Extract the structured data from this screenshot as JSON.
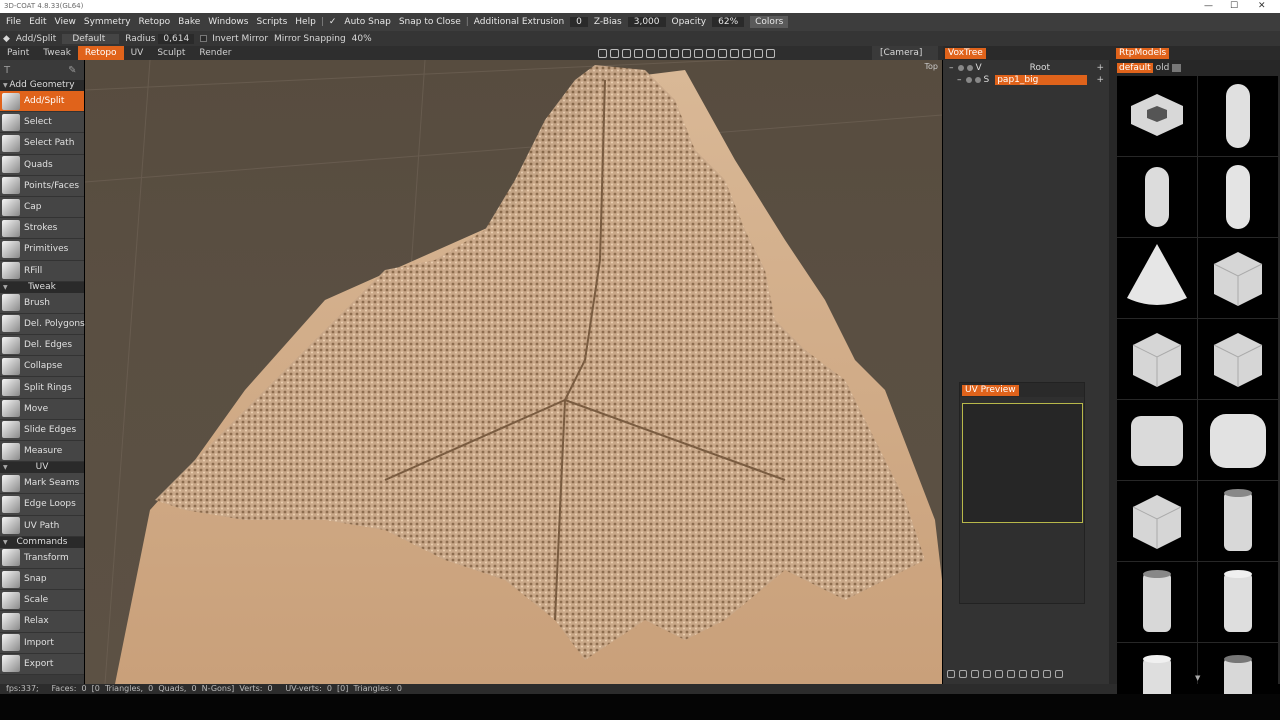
{
  "window": {
    "title": "3D-COAT 4.8.33(GL64)",
    "minimize": "—",
    "maximize": "☐",
    "close": "✕"
  },
  "menu": {
    "items": [
      "File",
      "Edit",
      "View",
      "Symmetry",
      "Retopo",
      "Bake",
      "Windows",
      "Scripts",
      "Help"
    ],
    "auto_snap": "Auto Snap",
    "snap_to_close": "Snap to Close",
    "additional_extrusion_label": "Additional Extrusion",
    "additional_extrusion_value": "0",
    "zbias_label": "Z-Bias",
    "zbias_value": "3,000",
    "opacity_label": "Opacity",
    "opacity_value": "62%",
    "colors": "Colors"
  },
  "options": {
    "tool": "Add/Split",
    "preset": "Default",
    "radius_label": "Radius",
    "radius_value": "0,614",
    "invert_mirror": "Invert Mirror",
    "mirror_snapping_label": "Mirror Snapping",
    "mirror_snapping_value": "40%"
  },
  "tabs": [
    {
      "label": "Paint",
      "active": false
    },
    {
      "label": "Tweak",
      "active": false
    },
    {
      "label": "Retopo",
      "active": true
    },
    {
      "label": "UV",
      "active": false
    },
    {
      "label": "Sculpt",
      "active": false
    },
    {
      "label": "Render",
      "active": false
    }
  ],
  "camera": "[Camera]",
  "viewport": {
    "view_label": "Top"
  },
  "toolbar": {
    "sections": [
      {
        "title": "Add Geometry",
        "tools": [
          {
            "label": "Add/Split",
            "active": true
          },
          {
            "label": "Select"
          },
          {
            "label": "Select Path"
          },
          {
            "label": "Quads"
          },
          {
            "label": "Points/Faces"
          },
          {
            "label": "Cap"
          },
          {
            "label": "Strokes"
          },
          {
            "label": "Primitives"
          },
          {
            "label": "RFill"
          }
        ]
      },
      {
        "title": "Tweak",
        "tools": [
          {
            "label": "Brush"
          },
          {
            "label": "Del. Polygons"
          },
          {
            "label": "Del. Edges"
          },
          {
            "label": "Collapse"
          },
          {
            "label": "Split Rings"
          },
          {
            "label": "Move"
          },
          {
            "label": "Slide Edges"
          },
          {
            "label": "Measure"
          }
        ]
      },
      {
        "title": "UV",
        "tools": [
          {
            "label": "Mark Seams"
          },
          {
            "label": "Edge Loops"
          },
          {
            "label": "UV Path"
          }
        ]
      },
      {
        "title": "Commands",
        "tools": [
          {
            "label": "Transform"
          },
          {
            "label": "Snap"
          },
          {
            "label": "Scale"
          },
          {
            "label": "Relax"
          },
          {
            "label": "Import"
          },
          {
            "label": "Export"
          }
        ]
      }
    ]
  },
  "status": {
    "text": "fps:337;     Faces:  0  [0  Triangles,  0  Quads,  0  N-Gons]  Verts:  0     UV-verts:  0  [0]  Triangles:  0"
  },
  "voxtree": {
    "title": "VoxTree",
    "root_prefix": "V",
    "root": "Root",
    "child_prefix": "S",
    "child": "pap1_big",
    "plus": "+"
  },
  "uv_preview": {
    "title": "UV Preview"
  },
  "rtpmodels": {
    "title": "RtpModels",
    "folder_active": "default",
    "folder_other": "old",
    "models": [
      "u-shape",
      "capsule",
      "capsule-short",
      "capsule-tall",
      "cone",
      "cube",
      "cube",
      "cube",
      "rounded-cube",
      "rounded-cube-soft",
      "cube",
      "tube",
      "tube",
      "cylinder",
      "cylinder-short",
      "tube-short"
    ]
  }
}
